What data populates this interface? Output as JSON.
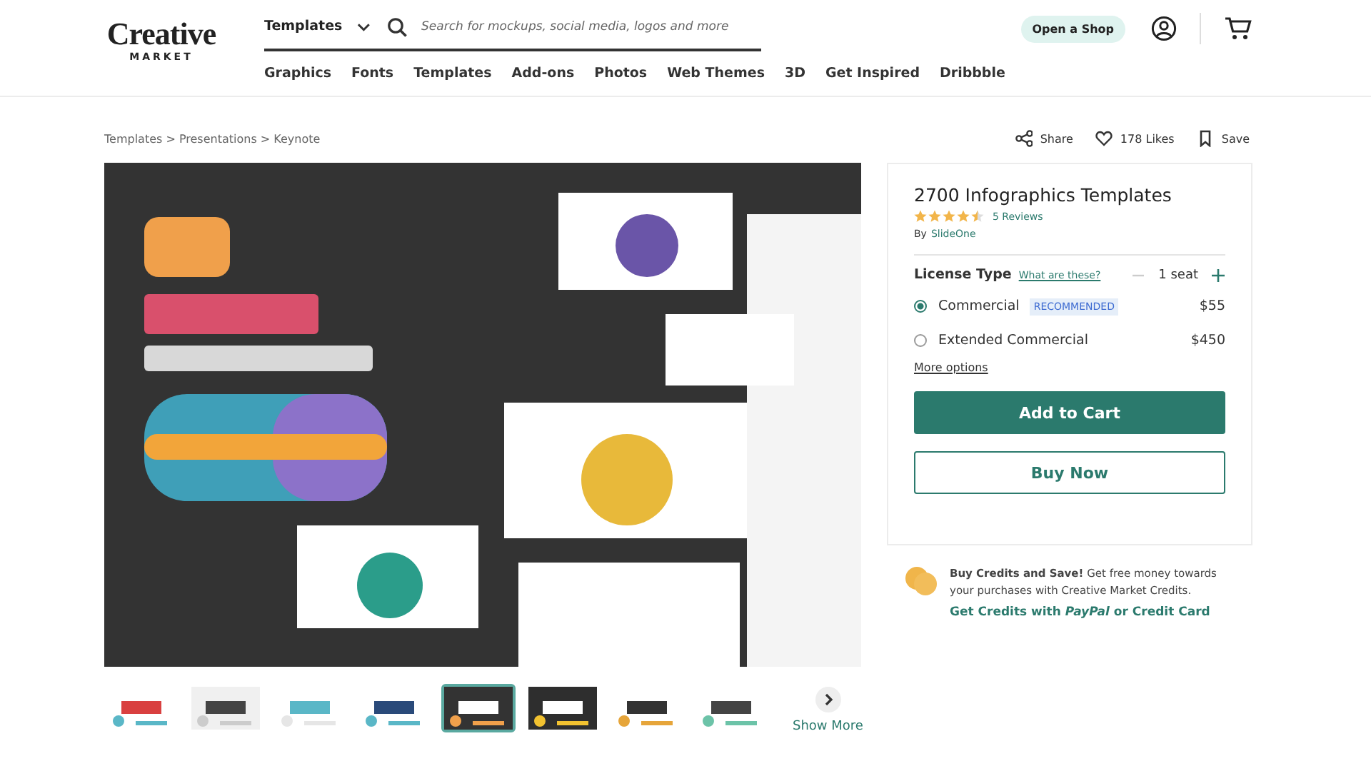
{
  "header": {
    "logo": {
      "line_1": "Creative",
      "line_2": "MARKET"
    },
    "category_select": "Templates",
    "search": {
      "placeholder": "Search for mockups, social media, logos and more"
    },
    "open_shop": "Open a Shop"
  },
  "nav": [
    "Graphics",
    "Fonts",
    "Templates",
    "Add-ons",
    "Photos",
    "Web Themes",
    "3D",
    "Get Inspired",
    "Dribbble"
  ],
  "breadcrumb": "Templates > Presentations > Keynote",
  "actions": [
    {
      "kind": "share",
      "label": "Share"
    },
    {
      "kind": "like",
      "label": "178 Likes"
    },
    {
      "kind": "save",
      "label": "Save"
    }
  ],
  "gallery": {
    "thumbnails": [
      {
        "selected": false
      },
      {
        "selected": false
      },
      {
        "selected": false
      },
      {
        "selected": false
      },
      {
        "selected": true
      },
      {
        "selected": false
      },
      {
        "selected": false
      },
      {
        "selected": false
      }
    ],
    "show_more": "Show More"
  },
  "product": {
    "title": "2700 Infographics Templates",
    "stars": 4.5,
    "reviews": "5 Reviews",
    "by": "By",
    "author": "SlideOne",
    "license": {
      "label": "License Type",
      "help": "What are these?",
      "seats": "1 seat",
      "options": [
        {
          "label": "Commercial",
          "badge": "RECOMMENDED",
          "price": "$55",
          "selected": true
        },
        {
          "label": "Extended Commercial",
          "price": "$450",
          "selected": false
        }
      ],
      "more_options": "More options"
    },
    "add_to_cart": "Add to Cart",
    "buy_now": "Buy Now"
  },
  "credits": {
    "text": "**Buy Credits and Save!** Get free money towards your purchases with Creative Market Credits.",
    "link": "Get Credits with *PayPal* or Credit Card"
  }
}
